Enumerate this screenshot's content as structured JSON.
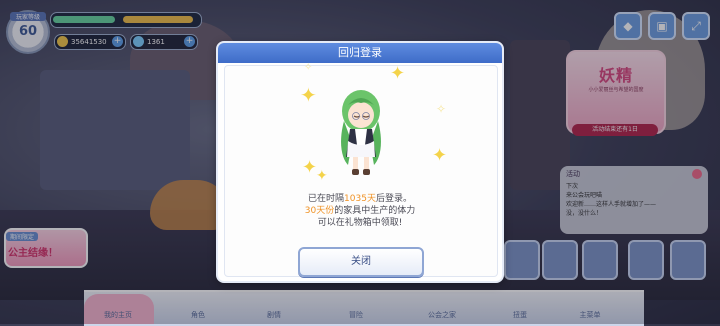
{
  "player": {
    "level_caption": "玩家等级",
    "level": "60",
    "resource_1": "35641530",
    "resource_2": "1361"
  },
  "top_icons": [
    "cat-icon",
    "window-icon",
    "expand-icon"
  ],
  "event_banner": {
    "title": "妖精",
    "subtitle": "小小爱丽丝与希望的国度",
    "time": "活动结束还有1日"
  },
  "news": {
    "header": "活动",
    "lines": [
      "下次",
      "来公会玩吧喵",
      "欢迎新……这样人手就增加了——",
      "没，没什么！"
    ]
  },
  "promo": {
    "tag": "期间限定",
    "title": "公主结缘！"
  },
  "bottom_nav": [
    "我的主页",
    "角色",
    "剧情",
    "冒险",
    "公会之家",
    "扭蛋",
    "主菜单"
  ],
  "dialog": {
    "title": "回归登录",
    "line1_prefix": "已在时隔",
    "line1_days": "1035天",
    "line1_suffix": "后登录。",
    "line2_days": "30天份",
    "line2_suffix": "的家具中生产的体力",
    "line3": "可以在礼物箱中领取!",
    "close_label": "关闭"
  },
  "colors": {
    "accent": "#3e6cc8",
    "highlight": "#f09326",
    "nav_active": "#f7b6cf"
  }
}
